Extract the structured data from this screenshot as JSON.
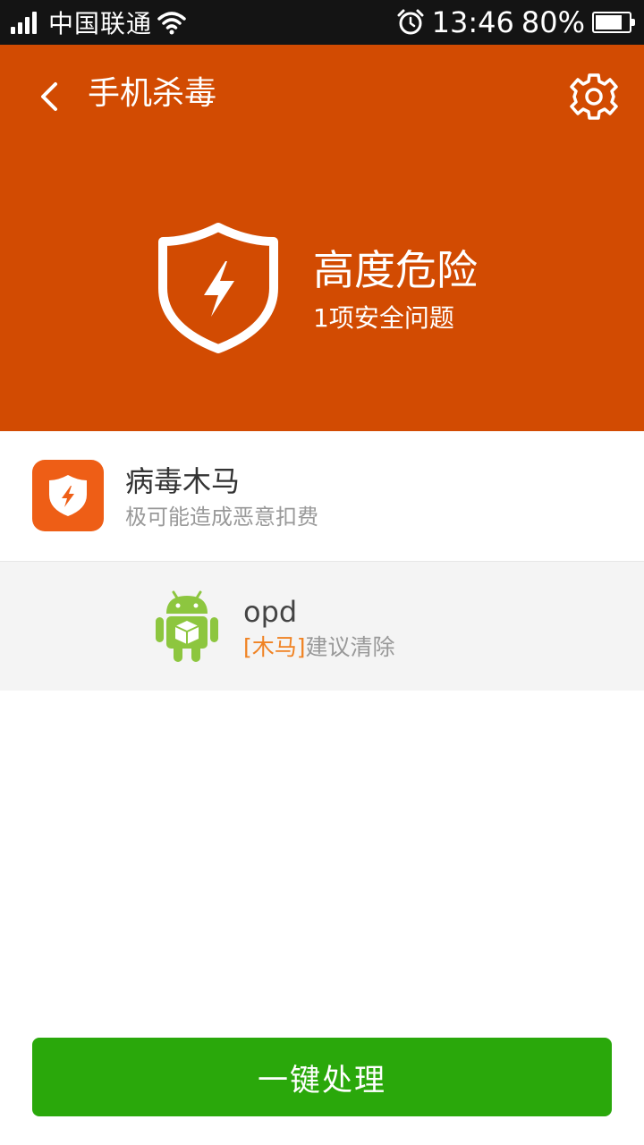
{
  "status_bar": {
    "carrier": "中国联通",
    "time": "13:46",
    "battery": "80%",
    "battery_level": 0.8,
    "icons": [
      "signal-icon",
      "wifi-icon",
      "alarm-icon",
      "battery-icon"
    ]
  },
  "header": {
    "title": "手机杀毒",
    "back_icon": "back-arrow-icon",
    "settings_icon": "gear-icon",
    "risk_level": "高度危险",
    "issue_count": "1项安全问题",
    "shield_icon": "shield-lightning-icon"
  },
  "category": {
    "title": "病毒木马",
    "description": "极可能造成恶意扣费",
    "icon": "shield-lightning-icon"
  },
  "threats": [
    {
      "app_name": "opd",
      "tag": "[木马]",
      "advice": "建议清除",
      "icon": "android-app-icon"
    }
  ],
  "action": {
    "button_label": "一键处理"
  },
  "colors": {
    "header_bg": "#d24b02",
    "category_icon_bg": "#ee5e16",
    "tag_color": "#f08222",
    "button_bg": "#2aa80b",
    "status_bar_bg": "#141414"
  }
}
